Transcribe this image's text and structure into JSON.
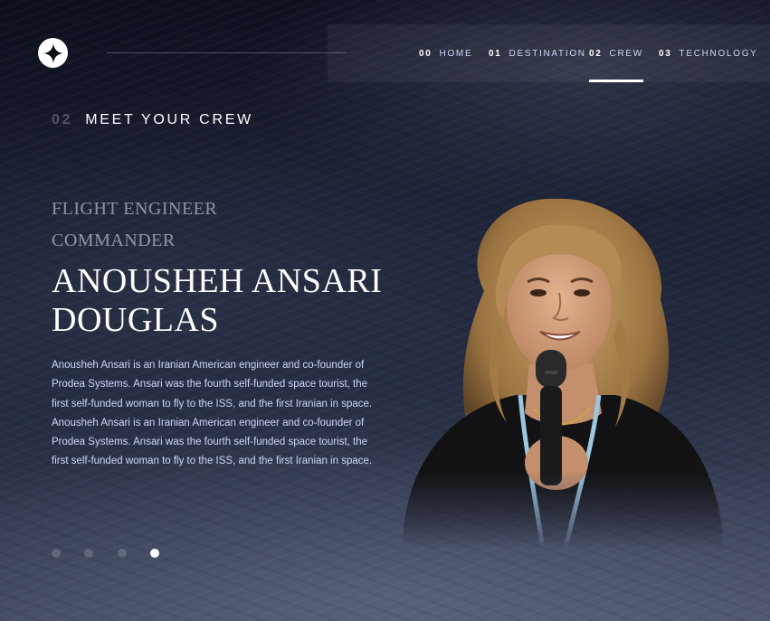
{
  "header": {
    "logo_icon": "star-logo-icon",
    "nav": [
      {
        "num": "00",
        "label": "HOME",
        "active": false
      },
      {
        "num": "01",
        "label": "DESTINATION",
        "active": false
      },
      {
        "num": "02",
        "label": "CREW",
        "active": true
      },
      {
        "num": "03",
        "label": "TECHNOLOGY",
        "active": false
      }
    ]
  },
  "section": {
    "num": "02",
    "title": "MEET YOUR CREW"
  },
  "crew": {
    "role_primary": "FLIGHT ENGINEER",
    "role_secondary": "COMMANDER",
    "name_line1": "ANOUSHEH ANSARI",
    "name_line2": "DOUGLAS",
    "bio": "Anousheh Ansari is an Iranian American engineer and co-founder of Prodea Systems. Ansari was the fourth self-funded space tourist, the first self-funded woman to fly to the ISS, and the first Iranian in space. Anousheh Ansari is an Iranian American engineer and co-founder of Prodea Systems. Ansari was the fourth self-funded space tourist, the first self-funded woman to fly to the ISS, and the first Iranian in space."
  },
  "pagination": {
    "count": 4,
    "active_index": 3
  },
  "colors": {
    "accent": "#ffffff",
    "text_muted": "#d0d6f9",
    "background": "#0b0d17"
  }
}
